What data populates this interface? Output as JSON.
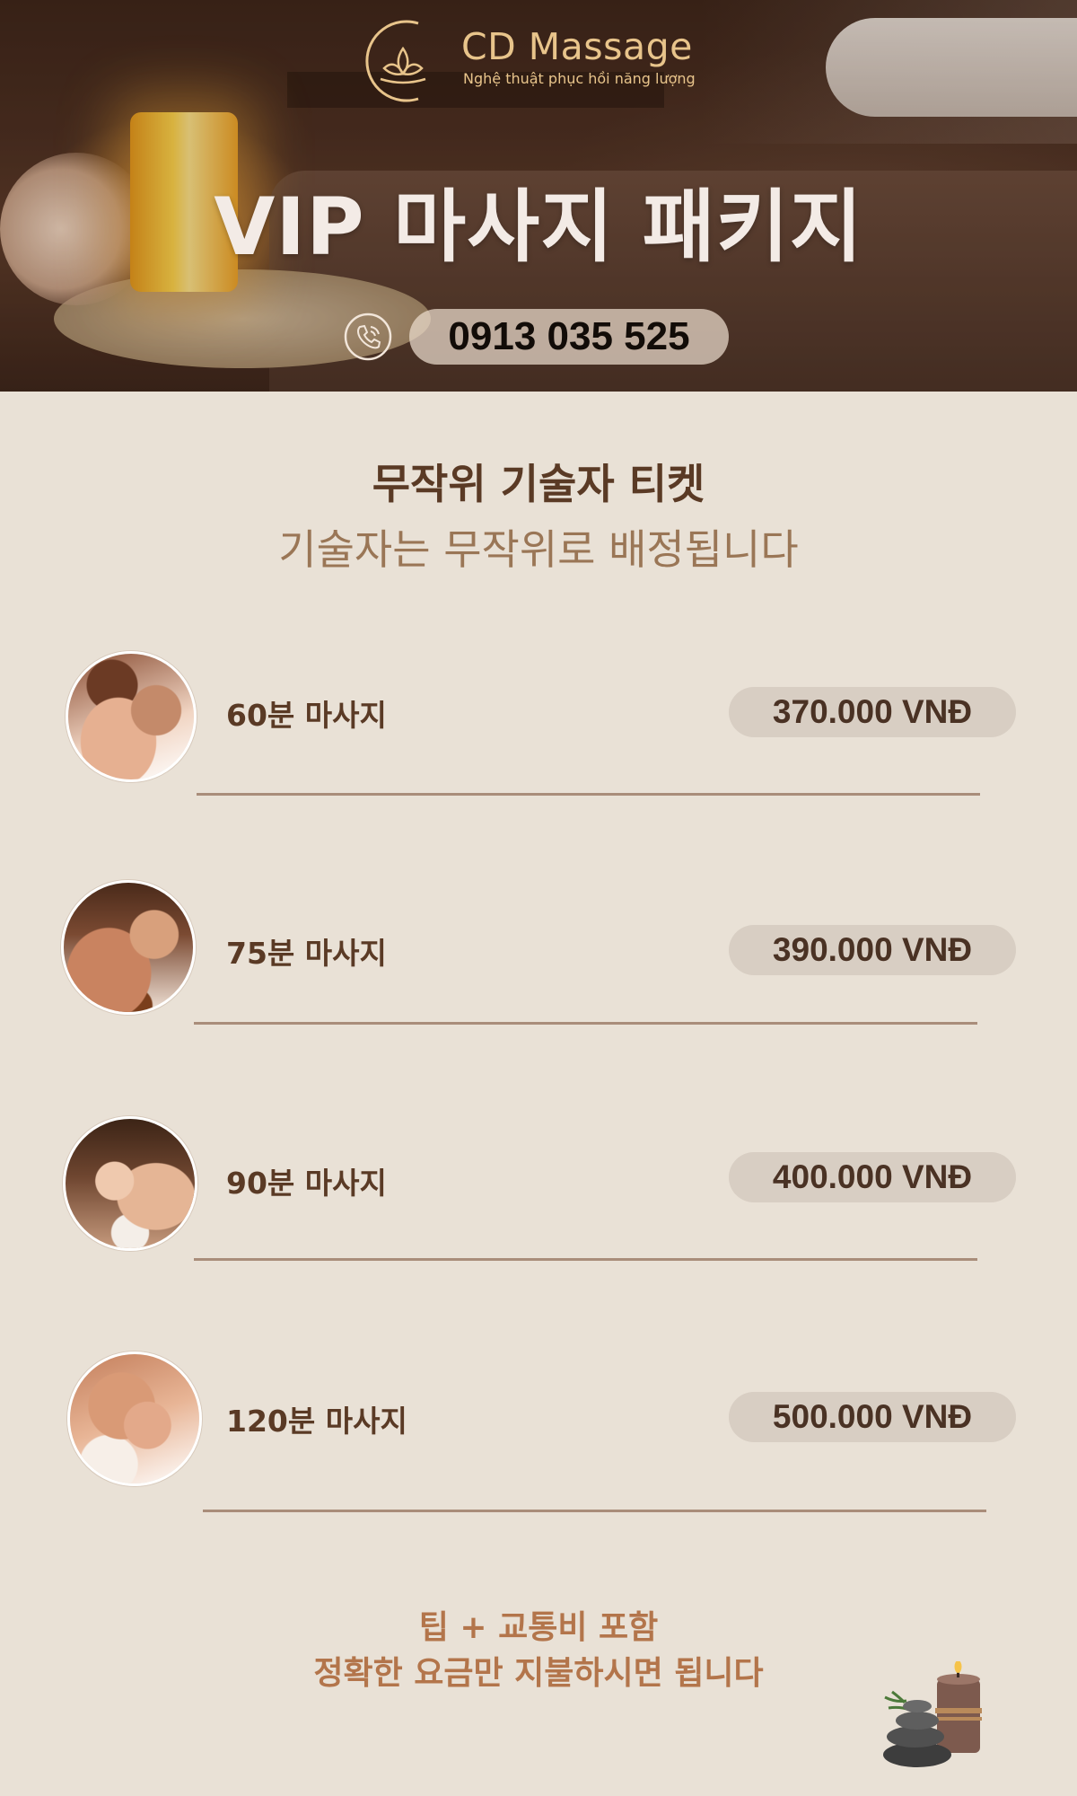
{
  "brand": {
    "name": "CD Massage",
    "tagline": "Nghệ thuật phục hồi năng lượng"
  },
  "hero": {
    "title": "VIP 마사지 패키지",
    "phone": "0913 035 525",
    "phone_icon": "phone-icon"
  },
  "section": {
    "title": "무작위 기술자 티켓",
    "subtitle": "기술자는 무작위로 배정됩니다"
  },
  "packages": [
    {
      "label": "60분 마사지",
      "price": "370.000 VNĐ"
    },
    {
      "label": "75분 마사지",
      "price": "390.000 VNĐ"
    },
    {
      "label": "90분 마사지",
      "price": "400.000 VNĐ"
    },
    {
      "label": "120분 마사지",
      "price": "500.000 VNĐ"
    }
  ],
  "footer": {
    "line1": "팁 + 교통비 포함",
    "line2": "정확한 요금만 지불하시면 됩니다"
  },
  "colors": {
    "page_background": "#e9e1d6",
    "brand_gold": "#e8c48b",
    "heading_brown": "#5a3a25",
    "subtitle_brown": "#9a7656",
    "price_pill": "#d8cec3",
    "footer_text": "#b3754b"
  }
}
